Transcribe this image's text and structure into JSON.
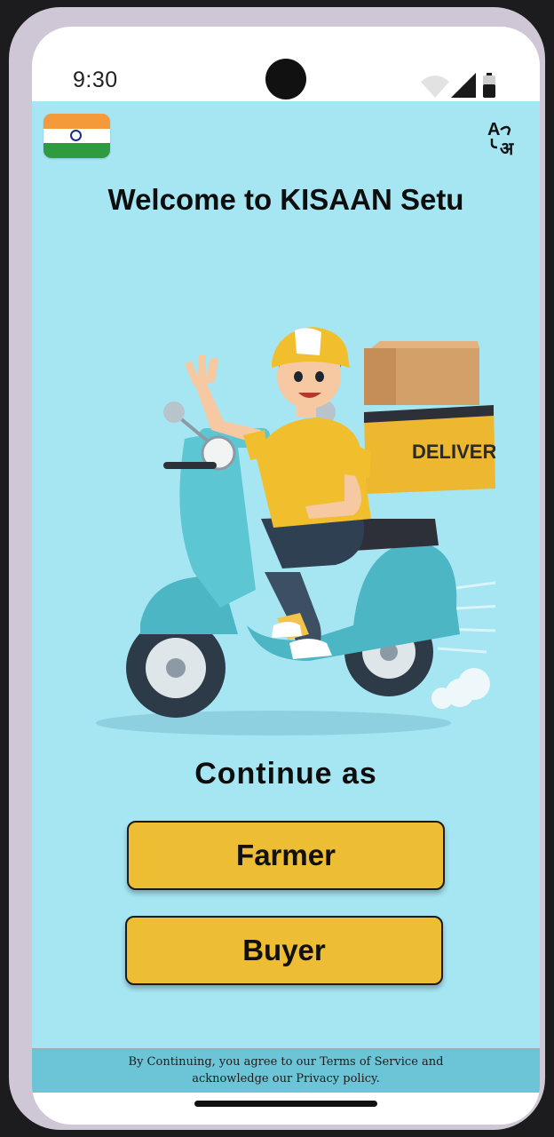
{
  "status_bar": {
    "time": "9:30"
  },
  "header": {
    "flag_icon": "india-flag-icon",
    "translate_icon": "translate-icon",
    "title": "Welcome to KISAAN Setu"
  },
  "illustration": {
    "icon": "delivery-scooter-illustration",
    "box_label": "DELIVERY"
  },
  "main": {
    "continue_label": "Continue as",
    "farmer_label": "Farmer",
    "buyer_label": "Buyer"
  },
  "footer": {
    "line1": "By Continuing, you agree to our Terms of Service and",
    "line2": "acknowledge our Privacy policy."
  },
  "colors": {
    "background": "#a6e6f3",
    "button": "#edbd33",
    "footer": "#6cc5d6"
  }
}
